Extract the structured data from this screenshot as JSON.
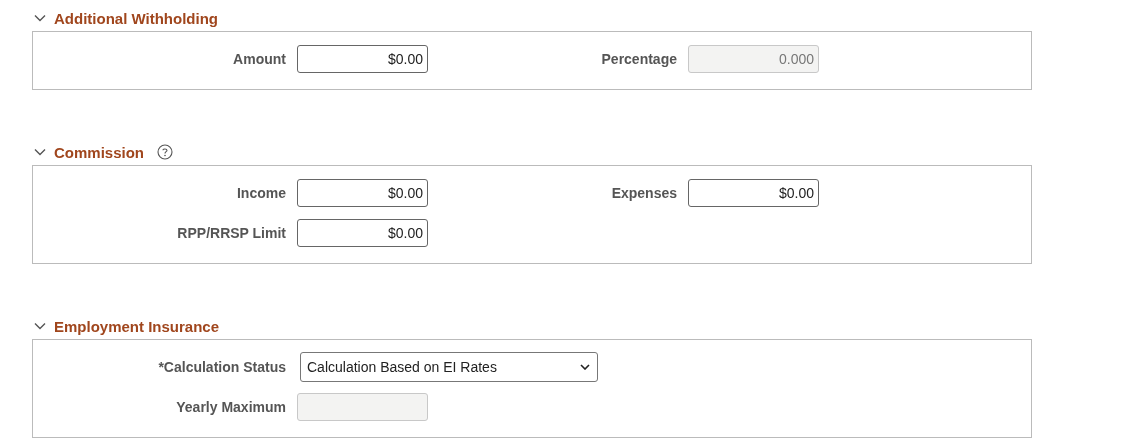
{
  "sections": [
    {
      "title": "Additional Withholding",
      "expanded": true,
      "rows": [
        [
          {
            "label": "Amount",
            "kind": "input",
            "value": "$0.00"
          },
          {
            "label": "Percentage",
            "kind": "disabled-input",
            "value": "0.000"
          }
        ]
      ]
    },
    {
      "title": "Commission",
      "expanded": true,
      "help": true,
      "rows": [
        [
          {
            "label": "Income",
            "kind": "input",
            "value": "$0.00"
          },
          {
            "label": "Expenses",
            "kind": "input",
            "value": "$0.00"
          }
        ],
        [
          {
            "label": "RPP/RRSP Limit",
            "kind": "input",
            "value": "$0.00"
          }
        ]
      ]
    },
    {
      "title": "Employment Insurance",
      "expanded": true,
      "rows": [
        [
          {
            "label": "*Calculation Status",
            "kind": "select",
            "value": "Calculation Based on EI Rates"
          }
        ],
        [
          {
            "label": "Yearly Maximum",
            "kind": "disabled-input"
          }
        ]
      ]
    }
  ]
}
